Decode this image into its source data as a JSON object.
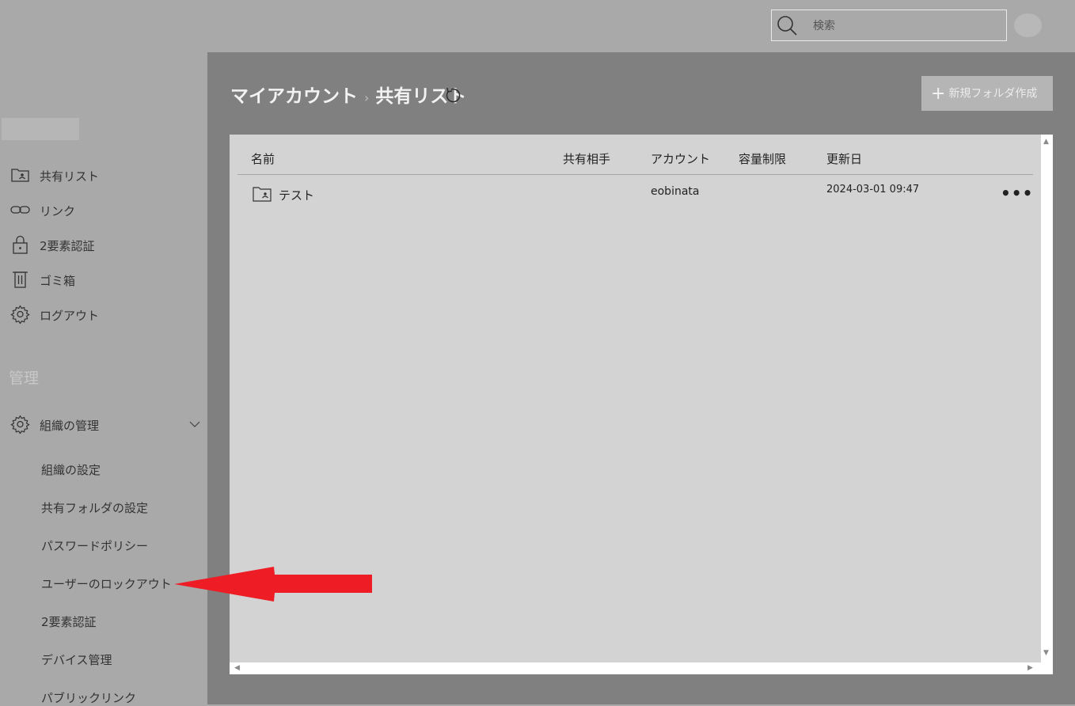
{
  "search": {
    "placeholder": "検索"
  },
  "sidebar": {
    "items": [
      {
        "label": "共有リスト",
        "icon": "shared-folder-icon"
      },
      {
        "label": "リンク",
        "icon": "link-icon"
      },
      {
        "label": "2要素認証",
        "icon": "lock-icon"
      },
      {
        "label": "ゴミ箱",
        "icon": "trash-icon"
      },
      {
        "label": "ログアウト",
        "icon": "gear-icon"
      }
    ],
    "section_title": "管理",
    "admin": {
      "label": "組織の管理",
      "icon": "gear-icon",
      "expanded": true,
      "subitems": [
        "組織の設定",
        "共有フォルダの設定",
        "パスワードポリシー",
        "ユーザーのロックアウト",
        "2要素認証",
        "デバイス管理",
        "パブリックリンク"
      ]
    }
  },
  "main": {
    "breadcrumb": [
      "マイアカウント",
      "共有リスト"
    ],
    "breadcrumb_separator": "›",
    "new_folder_label": "新規フォルダ作成",
    "table": {
      "headers": [
        "名前",
        "共有相手",
        "アカウント",
        "容量制限",
        "更新日"
      ],
      "rows": [
        {
          "name": "テスト",
          "shared_with": "",
          "account": "eobinata",
          "quota": "",
          "updated": "2024-03-01 09:47",
          "more": "•••"
        }
      ]
    }
  },
  "colors": {
    "annotation_arrow": "#ee1c25"
  }
}
